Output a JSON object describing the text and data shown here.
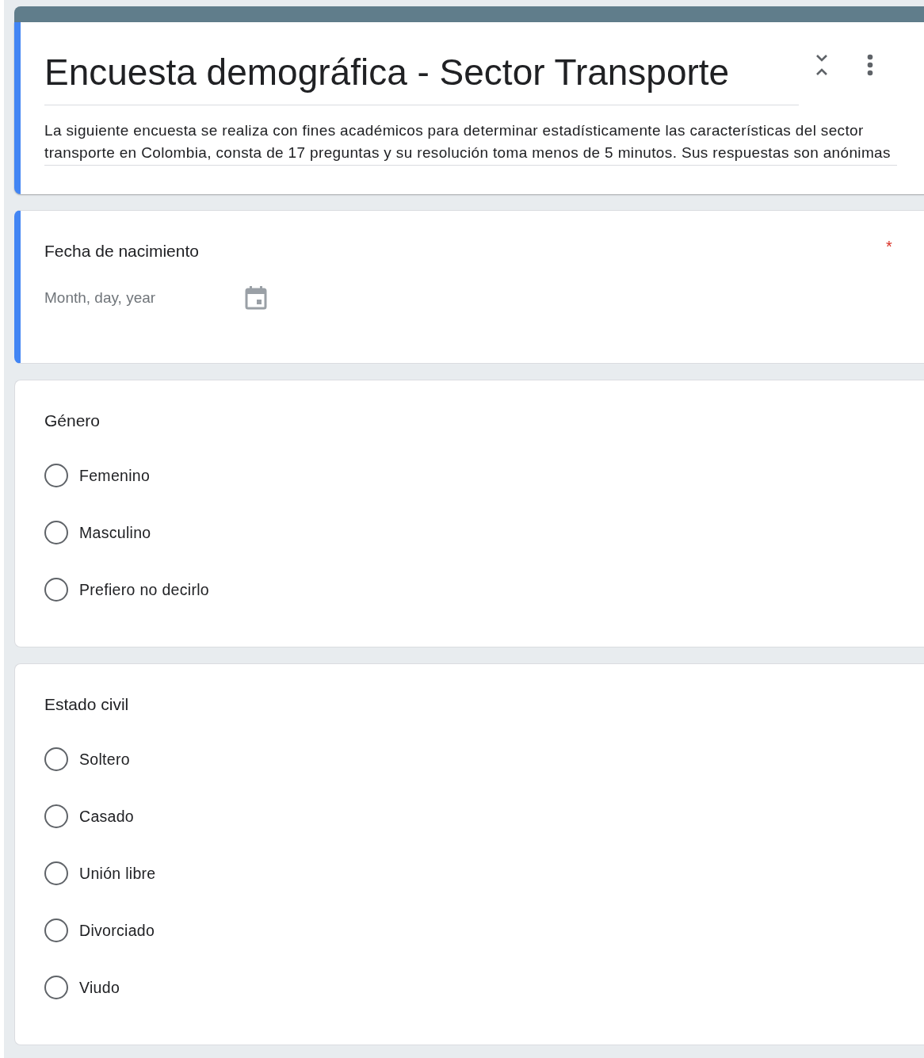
{
  "form": {
    "title": "Encuesta demográfica - Sector Transporte",
    "description": "La siguiente encuesta se realiza con fines académicos para determinar estadísticamente las características del sector transporte en Colombia, consta de 17 preguntas y su resolución toma menos de 5 minutos. Sus respuestas son anónimas"
  },
  "questions": [
    {
      "kind": "date",
      "title": "Fecha de nacimiento",
      "required_mark": "*",
      "focused": true,
      "placeholder": "Month, day, year"
    },
    {
      "kind": "radio",
      "title": "Género",
      "focused": false,
      "options": [
        {
          "label": "Femenino",
          "selected": false
        },
        {
          "label": "Masculino",
          "selected": false
        },
        {
          "label": "Prefiero no decirlo",
          "selected": false
        }
      ]
    },
    {
      "kind": "radio",
      "title": "Estado civil",
      "focused": false,
      "options": [
        {
          "label": "Soltero",
          "selected": false
        },
        {
          "label": "Casado",
          "selected": false
        },
        {
          "label": "Unión libre",
          "selected": false
        },
        {
          "label": "Divorciado",
          "selected": false
        },
        {
          "label": "Viudo",
          "selected": false
        }
      ]
    }
  ]
}
